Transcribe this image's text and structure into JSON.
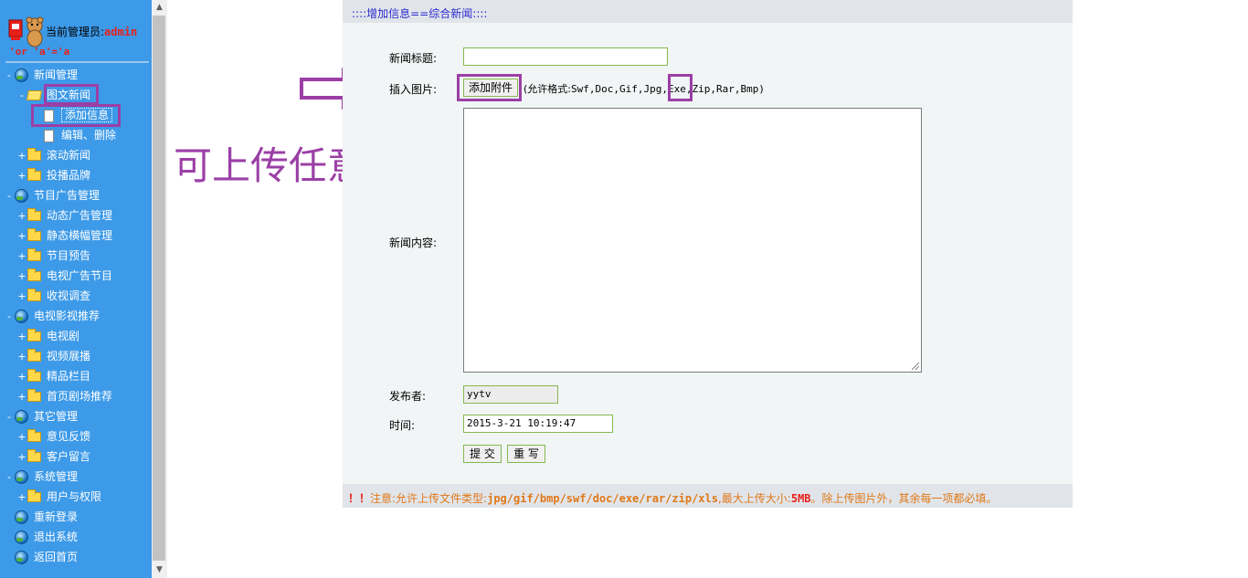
{
  "sidebar": {
    "admin_label": "当前管理员:",
    "admin_name": "admin",
    "admin_sub": "'or 'a'='a",
    "tree": [
      {
        "label": "新闻管理",
        "icon": "globe-icon",
        "toggle": "-"
      },
      {
        "label": "图文新闻",
        "icon": "folder-open-icon",
        "toggle": "-"
      },
      {
        "label": "添加信息",
        "icon": "page-icon",
        "toggle": ""
      },
      {
        "label": "编辑、删除",
        "icon": "page-icon",
        "toggle": ""
      },
      {
        "label": "滚动新闻",
        "icon": "folder-icon",
        "toggle": "+"
      },
      {
        "label": "投播品牌",
        "icon": "folder-icon",
        "toggle": "+"
      },
      {
        "label": "节目广告管理",
        "icon": "globe-icon",
        "toggle": "-"
      },
      {
        "label": "动态广告管理",
        "icon": "folder-icon",
        "toggle": "+"
      },
      {
        "label": "静态横幅管理",
        "icon": "folder-icon",
        "toggle": "+"
      },
      {
        "label": "节目预告",
        "icon": "folder-icon",
        "toggle": "+"
      },
      {
        "label": "电视广告节目",
        "icon": "folder-icon",
        "toggle": "+"
      },
      {
        "label": "收视调查",
        "icon": "folder-icon",
        "toggle": "+"
      },
      {
        "label": "电视影视推荐",
        "icon": "globe-icon",
        "toggle": "-"
      },
      {
        "label": "电视剧",
        "icon": "folder-icon",
        "toggle": "+"
      },
      {
        "label": "视频展播",
        "icon": "folder-icon",
        "toggle": "+"
      },
      {
        "label": "精品栏目",
        "icon": "folder-icon",
        "toggle": "+"
      },
      {
        "label": "首页剧场推荐",
        "icon": "folder-icon",
        "toggle": "+"
      },
      {
        "label": "其它管理",
        "icon": "globe-icon",
        "toggle": "-"
      },
      {
        "label": "意见反馈",
        "icon": "folder-icon",
        "toggle": "+"
      },
      {
        "label": "客户留言",
        "icon": "folder-icon",
        "toggle": "+"
      },
      {
        "label": "系统管理",
        "icon": "globe-icon",
        "toggle": "-"
      },
      {
        "label": "用户与权限",
        "icon": "folder-icon",
        "toggle": "+"
      },
      {
        "label": "重新登录",
        "icon": "globe-icon",
        "toggle": ""
      },
      {
        "label": "退出系统",
        "icon": "globe-icon",
        "toggle": ""
      },
      {
        "label": "返回首页",
        "icon": "globe-icon",
        "toggle": ""
      }
    ]
  },
  "panel": {
    "header": "::::增加信息==综合新闻::::",
    "title_label": "新闻标题:",
    "title_value": "",
    "image_label": "插入图片:",
    "attach_button": "添加附件",
    "allowed_prefix": "(允许格式:",
    "allowed_formats": "Swf,Doc,Gif,Jpg,",
    "allowed_exe": "Exe",
    "allowed_rest": ",Zip,Rar,Bmp)",
    "content_label": "新闻内容:",
    "publisher_label": "发布者:",
    "publisher_value": "yytv",
    "time_label": "时间:",
    "time_value": "2015-3-21 10:19:47",
    "submit_button": "提 交",
    "reset_button": "重 写",
    "footer_bang": "！！",
    "footer_note_1": "注意:允许上传文件类型:",
    "footer_types": "jpg/gif/bmp/swf/doc/exe/rar/zip/xls",
    "footer_note_2": ",最大上传大小:",
    "footer_size": "5MB",
    "footer_note_3": "。除上传图片外，其余每一项都必填。"
  },
  "annotation": {
    "text": "可上传任意exe文件",
    "color": "#9b3fa6"
  },
  "colors": {
    "sidebar_bg": "#3d9ae8",
    "panel_bg": "#f1f5f5",
    "header_text": "#2b2bcf",
    "note_text": "#e07818",
    "highlight": "#9b3fa6"
  }
}
